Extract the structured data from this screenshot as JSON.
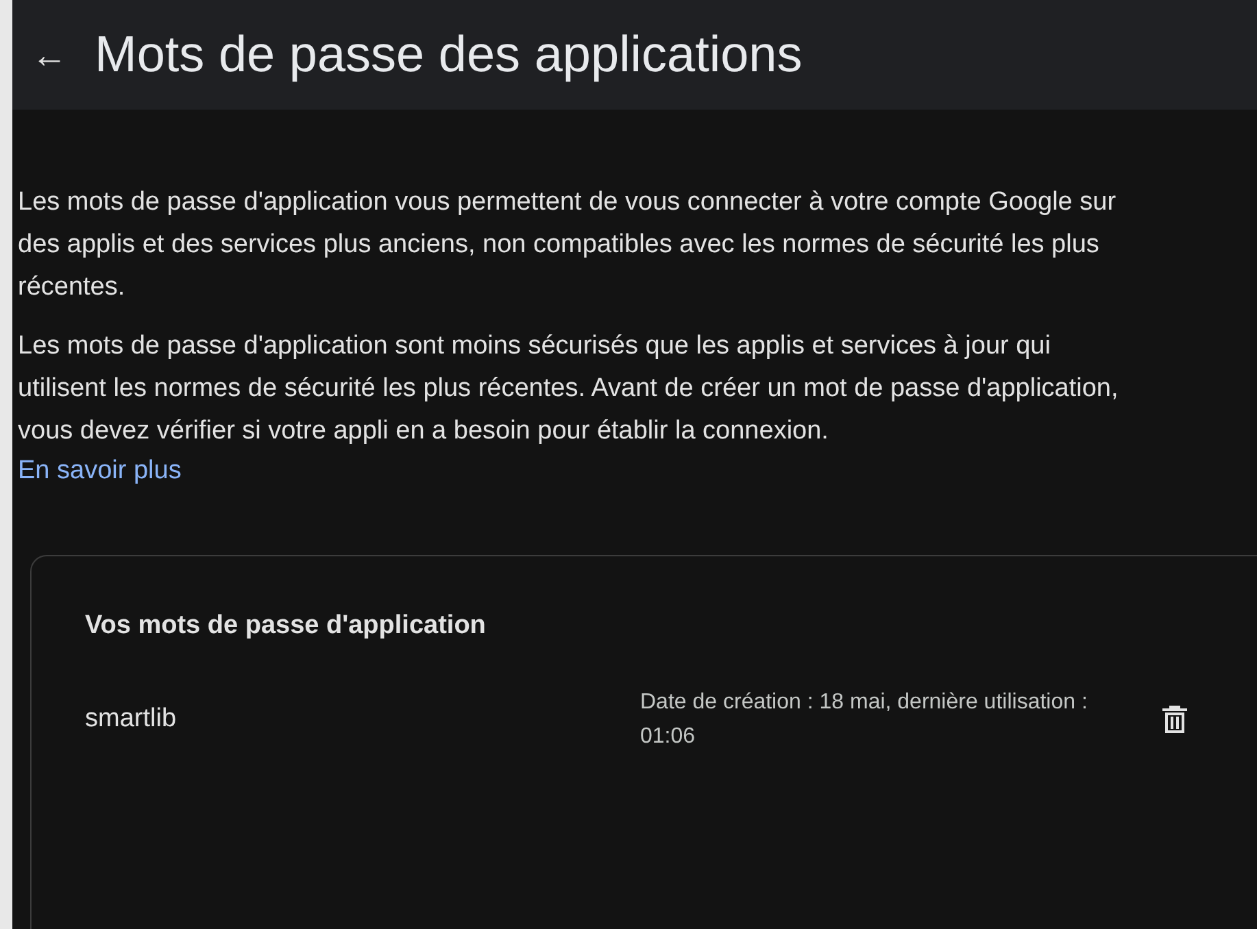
{
  "header": {
    "back_icon": "←",
    "title": "Mots de passe des applications"
  },
  "paragraphs": [
    "Les mots de passe d'application vous permettent de vous connecter à votre compte Google sur des applis et des services plus anciens, non compatibles avec les normes de sécurité les plus récentes.",
    "Les mots de passe d'application sont moins sécurisés que les applis et services à jour qui utilisent les normes de sécurité les plus récentes. Avant de créer un mot de passe d'application, vous devez vérifier si votre appli en a besoin pour établir la connexion."
  ],
  "learn_more": "En savoir plus",
  "card": {
    "title": "Vos mots de passe d'application",
    "passwords": [
      {
        "name": "smartlib",
        "details": "Date de création  : 18 mai, dernière utilisation : 01:06"
      }
    ]
  }
}
